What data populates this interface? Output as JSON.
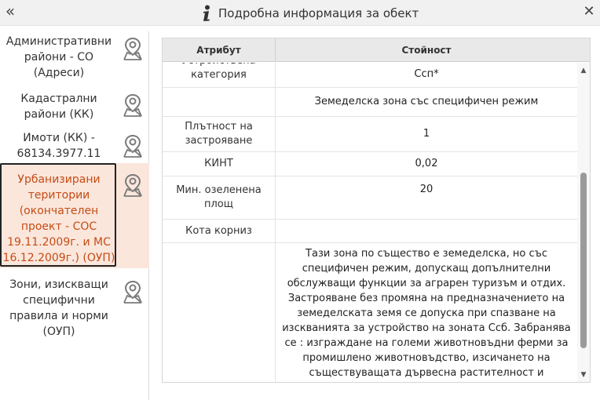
{
  "header": {
    "title": "Подробна информация за обект",
    "collapse_glyph": "«",
    "close_glyph": "✕"
  },
  "sidebar": {
    "items": [
      {
        "label": "Административни райони - СО (Адреси)",
        "icon": "map-marker-icon",
        "selected": false
      },
      {
        "label": "Кадастрални райони (КК)",
        "icon": "map-marker-icon",
        "selected": false
      },
      {
        "label": "Имоти (КК) - 68134.3977.11",
        "icon": "map-marker-icon",
        "selected": false
      },
      {
        "label": "Урбанизирани територии (окончателен проект - СОС 19.11.2009г. и МС 16.12.2009г.) (ОУП)",
        "icon": "map-marker-icon",
        "selected": true
      },
      {
        "label": "Зони, изискващи специфични правила и норми (ОУП)",
        "icon": "map-marker-icon",
        "selected": false
      }
    ]
  },
  "table": {
    "headers": {
      "attribute": "Атрибут",
      "value": "Стойност"
    },
    "rows": [
      {
        "attribute": "Устройствена категория",
        "value": "Ссп*"
      },
      {
        "attribute": "",
        "value": "Земеделска зона със специфичен режим"
      },
      {
        "attribute": "Плътност на застрояване",
        "value": "1"
      },
      {
        "attribute": "КИНТ",
        "value": "0,02"
      },
      {
        "attribute": "Мин. озеленена площ",
        "value": "20"
      },
      {
        "attribute": "Кота корниз",
        "value": ""
      },
      {
        "attribute": "",
        "value": "Тази зона по същество е земеделска, но със специфичен режим, допускащ допълнителни обслужващи функции за аграрен туризъм и отдих. Застрояване без промяна на предназначението на земеделската земя се допуска при спазване на изскванията за устройство на зоната Ссб. Забранява се : изграждане на големи животновъдни ферми за промишлено животновъдство, изсичането на съществуващата дървесна растителност и"
      }
    ]
  },
  "colors": {
    "selected_background": "#fbe6dc",
    "selected_text": "#c44d15",
    "header_background": "#f1f1f1"
  }
}
